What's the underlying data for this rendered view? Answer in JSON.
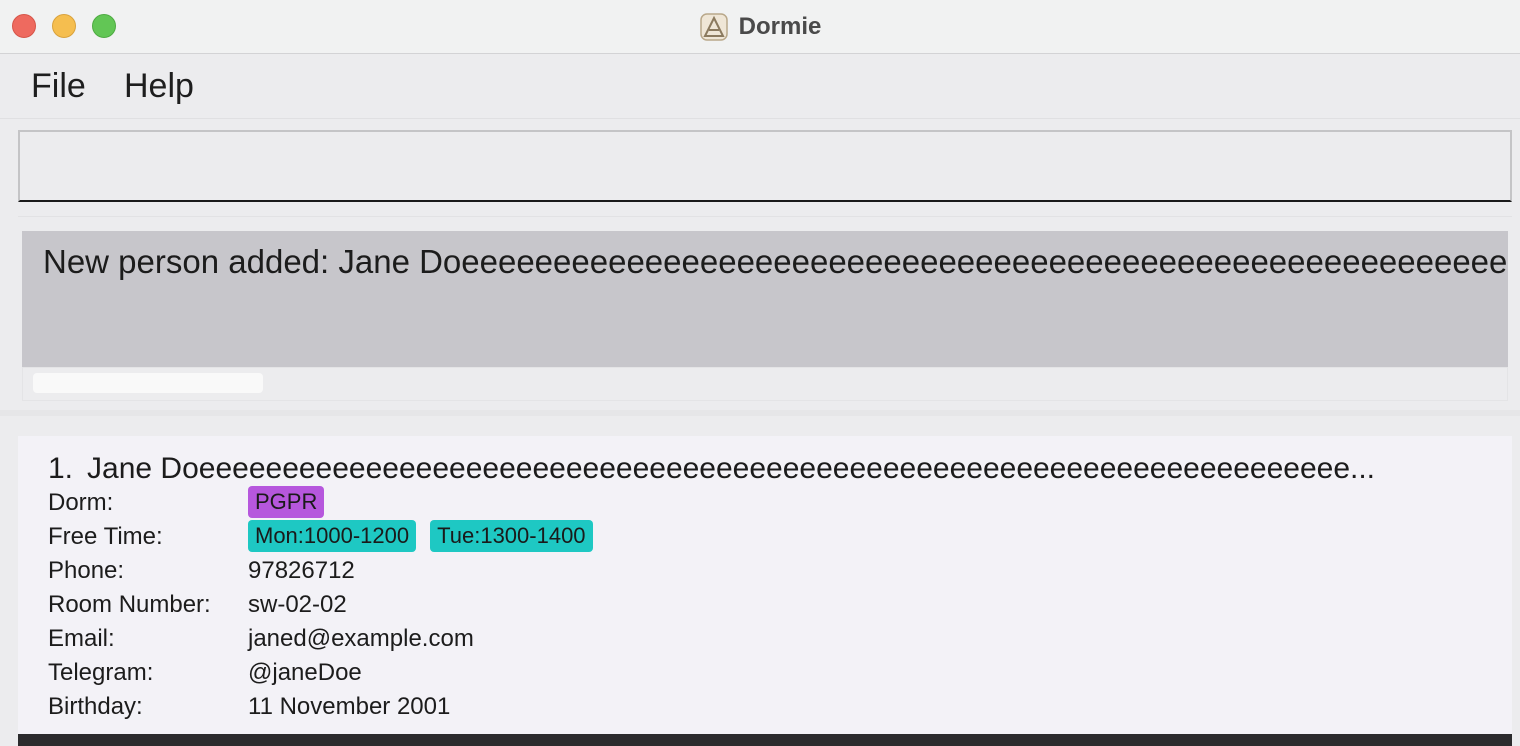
{
  "window": {
    "title": "Dormie"
  },
  "menu": {
    "file": "File",
    "help": "Help"
  },
  "command_box": {
    "value": "",
    "placeholder": ""
  },
  "result": {
    "message": "New person added: Jane Doeeeeeeeeeeeeeeeeeeeeeeeeeeeeeeeeeeeeeeeeeeeeeeeeeeeeeeeeeeeeeeeeeeeeeeeeeeeeeeee"
  },
  "person_list": [
    {
      "index": "1.",
      "name": "Jane Doeeeeeeeeeeeeeeeeeeeeeeeeeeeeeeeeeeeeeeeeeeeeeeeeeeeeeeeeeeeeeeeeeeeee...",
      "labels": {
        "dorm": "Dorm:",
        "free_time": "Free Time:",
        "phone": "Phone:",
        "room": "Room Number:",
        "email": "Email:",
        "telegram": "Telegram:",
        "birthday": "Birthday:"
      },
      "dorm_tag": "PGPR",
      "free_time_tags": [
        "Mon:1000-1200",
        "Tue:1300-1400"
      ],
      "phone": "97826712",
      "room": "sw-02-02",
      "email": "janed@example.com",
      "telegram": "@janeDoe",
      "birthday": "11 November 2001"
    }
  ],
  "colors": {
    "dorm_tag": "#b657dd",
    "free_time_tag": "#1ec8c3",
    "result_box": "#c7c6cb",
    "list_panel": "#f3f2f7"
  },
  "icons": {
    "app": "dormie-app-icon",
    "close": "close-window-icon",
    "minimize": "minimize-window-icon",
    "maximize": "maximize-window-icon"
  }
}
